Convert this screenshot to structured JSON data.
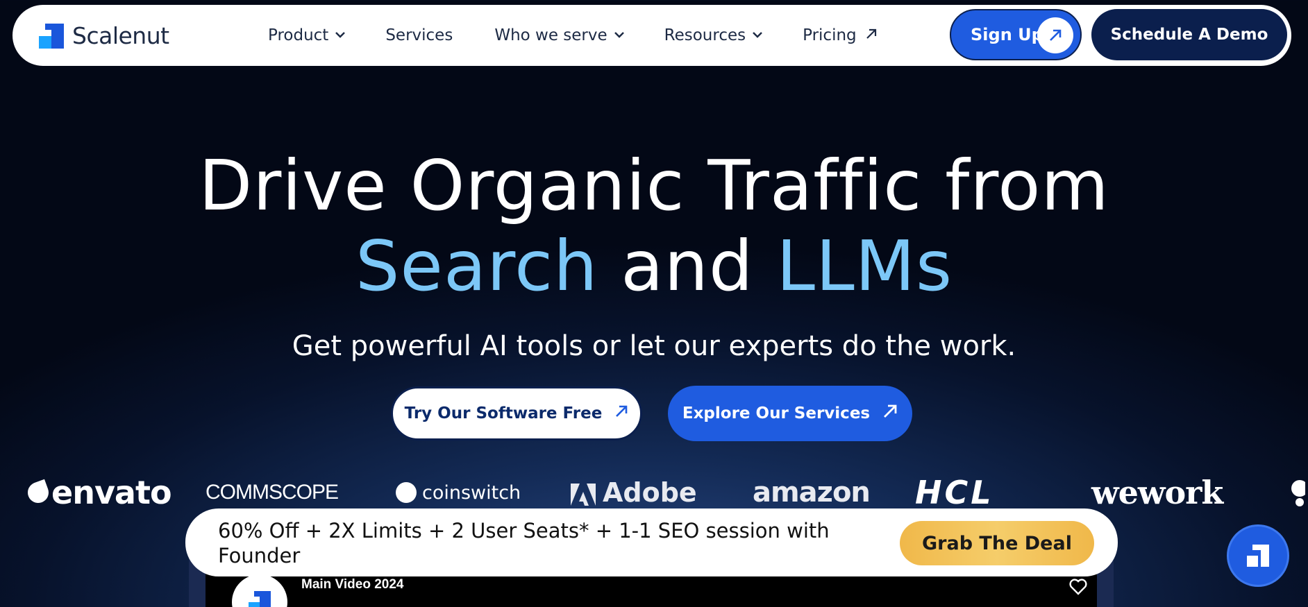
{
  "brand": {
    "name": "Scalenut"
  },
  "nav": {
    "items": [
      {
        "label": "Product",
        "dropdown": true
      },
      {
        "label": "Services",
        "dropdown": false
      },
      {
        "label": "Who we serve",
        "dropdown": true
      },
      {
        "label": "Resources",
        "dropdown": true
      },
      {
        "label": "Pricing",
        "external": true
      }
    ],
    "signup_label": "Sign Up",
    "demo_label": "Schedule A Demo"
  },
  "hero": {
    "title_line1": "Drive Organic Traffic from",
    "title_hl1": "Search",
    "title_mid": " and ",
    "title_hl2": "LLMs",
    "subtitle": "Get powerful AI tools or let our experts do the work.",
    "cta_primary": "Try Our Software Free",
    "cta_secondary": "Explore Our Services"
  },
  "logos": {
    "envato": "envato",
    "commscope": "COMMSCOPE",
    "coinswitch": "coinswitch",
    "adobe": "Adobe",
    "amazon": "amazon",
    "hcl": "HCL",
    "wework": "wework"
  },
  "video": {
    "title": "Main Video 2024"
  },
  "promo": {
    "text": "60% Off + 2X Limits + 2 User Seats* + 1-1 SEO session with Founder",
    "cta": "Grab The Deal"
  },
  "colors": {
    "primary": "#1f5ce0",
    "navy": "#0b1f4d",
    "highlight": "#7cc7f7",
    "deal_gold": "#f5c65a"
  },
  "icons": {
    "chevron": "chevron-down-icon",
    "external": "arrow-up-right-icon",
    "chat": "scalenut-chat-icon",
    "heart": "heart-icon"
  }
}
